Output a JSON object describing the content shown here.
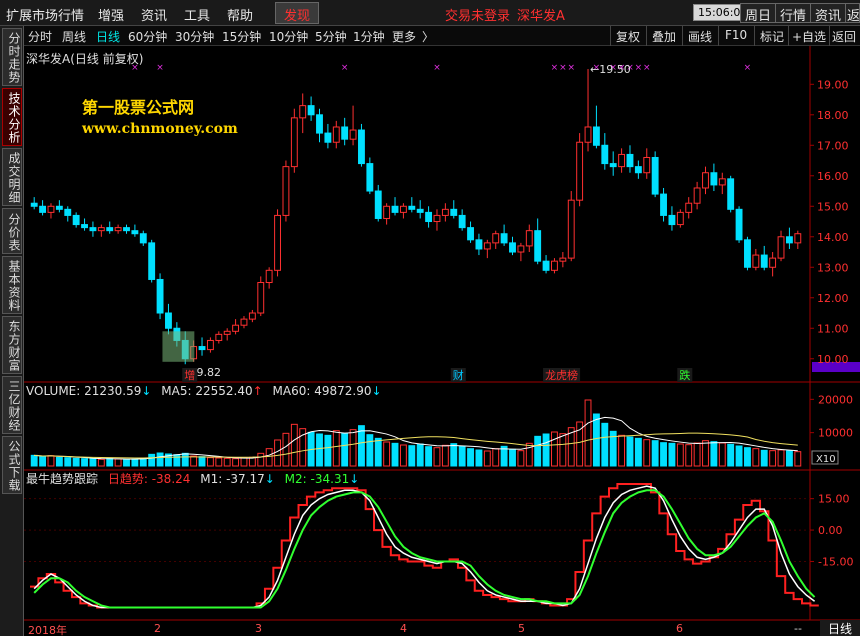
{
  "menu": {
    "items": [
      "扩展市场行情",
      "增强",
      "资讯",
      "工具",
      "帮助"
    ],
    "active": "发现",
    "title_status": "交易未登录",
    "title_stock": "深华发A",
    "clock": "15:06:08",
    "buttons": [
      "周日",
      "行情",
      "资讯",
      "返回"
    ]
  },
  "periods": {
    "items": [
      "分时",
      "周线",
      "日线",
      "60分钟",
      "30分钟",
      "15分钟",
      "10分钟",
      "5分钟",
      "1分钟",
      "更多"
    ],
    "selected": "日线",
    "more_arrow": "〉"
  },
  "right_tools": [
    "复权",
    "叠加",
    "画线",
    "F10",
    "标记",
    "+自选",
    "返回"
  ],
  "left_tabs": [
    "分时走势",
    "技术分析",
    "成交明细",
    "分价表",
    "基本资料",
    "东方财富",
    "三亿财经",
    "公式下载"
  ],
  "left_tab_active": "技术分析",
  "stock_title": "深华发A(日线 前复权)",
  "watermark": {
    "cn": "第一股票公式网",
    "url": "www.chnmoney.com"
  },
  "price_axis": {
    "labels": [
      "19.00",
      "18.00",
      "17.00",
      "16.00",
      "15.00",
      "14.00",
      "13.00",
      "12.00",
      "11.00",
      "10.00"
    ]
  },
  "price_annotations": {
    "high": "19.50",
    "low": "9.82"
  },
  "event_markers": [
    "增",
    "财",
    "龙虎榜",
    "跌"
  ],
  "volume_legend": {
    "label": "VOLUME:",
    "value": "21230.59",
    "ma5_label": "MA5:",
    "ma5_value": "22552.40",
    "ma60_label": "MA60:",
    "ma60_value": "49872.90"
  },
  "volume_axis": {
    "labels": [
      "20000",
      "10000"
    ],
    "unit": "X10"
  },
  "trend_legend": {
    "title": "最牛趋势跟踪",
    "day_label": "日趋势:",
    "day_value": "-38.24",
    "m1_label": "M1:",
    "m1_value": "-37.17",
    "m2_label": "M2:",
    "m2_value": "-34.31"
  },
  "trend_axis": {
    "labels": [
      "15.00",
      "0.00",
      "-15.00"
    ]
  },
  "x_axis": {
    "labels": [
      "2018年",
      "2",
      "3",
      "4",
      "5",
      "6"
    ]
  },
  "period_footer": "日线",
  "footer_dash": "--",
  "colors": {
    "up": "#ff3030",
    "down": "#00e0ff",
    "ma_white": "#ffffff",
    "ma_yellow": "#f0e060",
    "trend_red": "#ff2020",
    "trend_green": "#30ff30",
    "axis_red": "#a00000"
  },
  "chart_data": [
    {
      "type": "candlestick",
      "ylim": [
        9.5,
        19.6
      ],
      "ohlc": [
        [
          15.1,
          15.3,
          14.9,
          15.0
        ],
        [
          15.0,
          15.2,
          14.7,
          14.8
        ],
        [
          14.8,
          15.1,
          14.6,
          15.0
        ],
        [
          15.0,
          15.2,
          14.8,
          14.9
        ],
        [
          14.9,
          15.0,
          14.5,
          14.7
        ],
        [
          14.7,
          14.8,
          14.3,
          14.4
        ],
        [
          14.4,
          14.6,
          14.2,
          14.3
        ],
        [
          14.3,
          14.5,
          14.0,
          14.2
        ],
        [
          14.2,
          14.4,
          14.0,
          14.3
        ],
        [
          14.3,
          14.5,
          14.1,
          14.2
        ],
        [
          14.2,
          14.4,
          14.1,
          14.3
        ],
        [
          14.3,
          14.4,
          14.1,
          14.2
        ],
        [
          14.2,
          14.4,
          14.0,
          14.1
        ],
        [
          14.1,
          14.2,
          13.7,
          13.8
        ],
        [
          13.8,
          13.9,
          12.5,
          12.6
        ],
        [
          12.6,
          12.8,
          11.3,
          11.5
        ],
        [
          11.5,
          11.8,
          10.8,
          11.0
        ],
        [
          11.0,
          11.2,
          10.4,
          10.6
        ],
        [
          10.6,
          10.9,
          9.82,
          10.0
        ],
        [
          10.0,
          10.6,
          9.9,
          10.4
        ],
        [
          10.4,
          10.7,
          10.1,
          10.3
        ],
        [
          10.3,
          10.7,
          10.2,
          10.6
        ],
        [
          10.6,
          10.9,
          10.5,
          10.8
        ],
        [
          10.8,
          11.0,
          10.6,
          10.9
        ],
        [
          10.9,
          11.3,
          10.8,
          11.1
        ],
        [
          11.1,
          11.4,
          11.0,
          11.3
        ],
        [
          11.3,
          11.6,
          11.2,
          11.5
        ],
        [
          11.5,
          12.7,
          11.4,
          12.5
        ],
        [
          12.5,
          13.0,
          12.3,
          12.9
        ],
        [
          12.9,
          14.9,
          12.7,
          14.7
        ],
        [
          14.7,
          16.5,
          14.5,
          16.3
        ],
        [
          16.3,
          18.2,
          16.1,
          17.9
        ],
        [
          17.9,
          18.7,
          17.4,
          18.3
        ],
        [
          18.3,
          18.6,
          17.8,
          18.0
        ],
        [
          18.0,
          18.2,
          17.1,
          17.4
        ],
        [
          17.4,
          17.7,
          16.9,
          17.1
        ],
        [
          17.1,
          17.8,
          16.9,
          17.6
        ],
        [
          17.6,
          17.9,
          17.0,
          17.2
        ],
        [
          17.2,
          18.3,
          17.0,
          17.5
        ],
        [
          17.5,
          17.7,
          16.3,
          16.4
        ],
        [
          16.4,
          16.6,
          15.4,
          15.5
        ],
        [
          15.5,
          15.7,
          14.5,
          14.6
        ],
        [
          14.6,
          15.1,
          14.4,
          15.0
        ],
        [
          15.0,
          15.3,
          14.7,
          14.8
        ],
        [
          14.8,
          15.1,
          14.6,
          15.0
        ],
        [
          15.0,
          15.3,
          14.8,
          14.9
        ],
        [
          14.9,
          15.2,
          14.6,
          14.8
        ],
        [
          14.8,
          15.0,
          14.3,
          14.5
        ],
        [
          14.5,
          14.9,
          14.2,
          14.7
        ],
        [
          14.7,
          15.1,
          14.5,
          14.9
        ],
        [
          14.9,
          15.2,
          14.6,
          14.7
        ],
        [
          14.7,
          14.9,
          14.2,
          14.3
        ],
        [
          14.3,
          14.5,
          13.8,
          13.9
        ],
        [
          13.9,
          14.1,
          13.4,
          13.6
        ],
        [
          13.6,
          13.9,
          13.3,
          13.8
        ],
        [
          13.8,
          14.2,
          13.6,
          14.1
        ],
        [
          14.1,
          14.4,
          13.7,
          13.8
        ],
        [
          13.8,
          14.0,
          13.4,
          13.5
        ],
        [
          13.5,
          13.8,
          13.2,
          13.7
        ],
        [
          13.7,
          14.4,
          13.5,
          14.2
        ],
        [
          14.2,
          14.6,
          13.1,
          13.2
        ],
        [
          13.2,
          13.4,
          12.8,
          12.9
        ],
        [
          12.9,
          13.3,
          12.8,
          13.2
        ],
        [
          13.2,
          13.5,
          13.0,
          13.3
        ],
        [
          13.3,
          15.5,
          13.2,
          15.2
        ],
        [
          15.2,
          17.4,
          15.0,
          17.1
        ],
        [
          17.1,
          19.5,
          16.8,
          17.6
        ],
        [
          17.6,
          18.3,
          16.9,
          17.0
        ],
        [
          17.0,
          17.4,
          16.2,
          16.4
        ],
        [
          16.4,
          16.8,
          16.0,
          16.3
        ],
        [
          16.3,
          16.9,
          16.1,
          16.7
        ],
        [
          16.7,
          17.0,
          16.1,
          16.3
        ],
        [
          16.3,
          16.5,
          15.9,
          16.1
        ],
        [
          16.1,
          16.9,
          15.9,
          16.6
        ],
        [
          16.6,
          16.8,
          15.3,
          15.4
        ],
        [
          15.4,
          15.6,
          14.5,
          14.7
        ],
        [
          14.7,
          15.0,
          14.2,
          14.4
        ],
        [
          14.4,
          14.9,
          14.3,
          14.8
        ],
        [
          14.8,
          15.3,
          14.6,
          15.1
        ],
        [
          15.1,
          15.8,
          14.9,
          15.6
        ],
        [
          15.6,
          16.3,
          15.4,
          16.1
        ],
        [
          16.1,
          16.4,
          15.5,
          15.7
        ],
        [
          15.7,
          16.1,
          15.4,
          15.9
        ],
        [
          15.9,
          16.0,
          14.8,
          14.9
        ],
        [
          14.9,
          15.0,
          13.8,
          13.9
        ],
        [
          13.9,
          14.0,
          12.9,
          13.0
        ],
        [
          13.0,
          13.6,
          12.9,
          13.4
        ],
        [
          13.4,
          13.7,
          12.9,
          13.0
        ],
        [
          13.0,
          13.5,
          12.7,
          13.3
        ],
        [
          13.3,
          14.2,
          13.2,
          14.0
        ],
        [
          14.0,
          14.3,
          13.6,
          13.8
        ],
        [
          13.8,
          14.2,
          13.6,
          14.1
        ]
      ],
      "volume": [
        3200,
        2800,
        3100,
        2600,
        2500,
        2300,
        2200,
        2100,
        2000,
        2300,
        2100,
        1900,
        2000,
        2400,
        3500,
        3900,
        3600,
        3400,
        3800,
        3000,
        2800,
        2500,
        2400,
        2300,
        2200,
        2400,
        2600,
        3800,
        5200,
        7800,
        9800,
        12500,
        11200,
        10100,
        9600,
        9200,
        10600,
        9800,
        10900,
        12100,
        9400,
        8300,
        7200,
        6800,
        6300,
        6100,
        6600,
        5800,
        5500,
        6200,
        6700,
        6000,
        5200,
        4800,
        4500,
        5200,
        5900,
        5000,
        4600,
        6800,
        8900,
        9600,
        10200,
        9700,
        11500,
        13200,
        19800,
        15600,
        12800,
        10400,
        9200,
        8700,
        8300,
        7900,
        7600,
        7000,
        6800,
        6600,
        6400,
        6900,
        7600,
        7300,
        6900,
        6500,
        6000,
        5500,
        5200,
        4700,
        4600,
        4800,
        4500,
        4300
      ],
      "trend": [
        -27,
        -23,
        -21,
        -25,
        -29,
        -32,
        -35,
        -36,
        -37,
        -37,
        -37,
        -37,
        -37,
        -37,
        -37,
        -37,
        -37,
        -37,
        -37,
        -37,
        -37,
        -37,
        -37,
        -37,
        -37,
        -37,
        -37,
        -35,
        -28,
        -18,
        -5,
        6,
        12,
        16,
        18,
        19,
        20,
        20,
        20,
        19,
        10,
        0,
        -8,
        -12,
        -14,
        -15,
        -15,
        -17,
        -18,
        -15,
        -14,
        -18,
        -24,
        -29,
        -31,
        -32,
        -33,
        -34,
        -34,
        -33,
        -34,
        -35,
        -36,
        -36,
        -33,
        -20,
        -5,
        8,
        16,
        20,
        22,
        22,
        22,
        22,
        18,
        8,
        -2,
        -10,
        -14,
        -16,
        -15,
        -13,
        -9,
        -2,
        5,
        12,
        14,
        9,
        -5,
        -22,
        -30,
        -33,
        -35,
        -36
      ],
      "m1": [
        -28,
        -24,
        -21,
        -23,
        -27,
        -31,
        -34,
        -36,
        -37,
        -37,
        -37,
        -37,
        -37,
        -37,
        -37,
        -37,
        -37,
        -37,
        -37,
        -37,
        -37,
        -37,
        -37,
        -37,
        -37,
        -37,
        -37,
        -36,
        -32,
        -24,
        -13,
        -2,
        7,
        12,
        15,
        17,
        18,
        19,
        19,
        18,
        14,
        6,
        -2,
        -8,
        -11,
        -13,
        -14,
        -15,
        -16,
        -15,
        -15,
        -16,
        -20,
        -25,
        -29,
        -31,
        -32,
        -33,
        -34,
        -34,
        -34,
        -35,
        -35,
        -36,
        -35,
        -28,
        -16,
        -4,
        6,
        13,
        17,
        19,
        20,
        21,
        20,
        14,
        5,
        -3,
        -9,
        -13,
        -14,
        -13,
        -11,
        -6,
        0,
        6,
        10,
        10,
        2,
        -11,
        -21,
        -27,
        -31,
        -34
      ],
      "m2": [
        -30,
        -26,
        -23,
        -23,
        -25,
        -29,
        -32,
        -34,
        -36,
        -37,
        -37,
        -37,
        -37,
        -37,
        -37,
        -37,
        -37,
        -37,
        -37,
        -37,
        -37,
        -37,
        -37,
        -37,
        -37,
        -37,
        -37,
        -37,
        -34,
        -28,
        -19,
        -9,
        0,
        7,
        11,
        14,
        16,
        17,
        18,
        18,
        16,
        11,
        4,
        -3,
        -8,
        -11,
        -13,
        -14,
        -15,
        -15,
        -15,
        -15,
        -17,
        -22,
        -26,
        -29,
        -31,
        -32,
        -33,
        -33,
        -34,
        -34,
        -35,
        -35,
        -35,
        -31,
        -22,
        -11,
        -1,
        8,
        13,
        16,
        18,
        19,
        19,
        16,
        10,
        3,
        -4,
        -9,
        -12,
        -12,
        -11,
        -8,
        -3,
        2,
        6,
        8,
        4,
        -5,
        -15,
        -22,
        -28,
        -32
      ]
    }
  ]
}
